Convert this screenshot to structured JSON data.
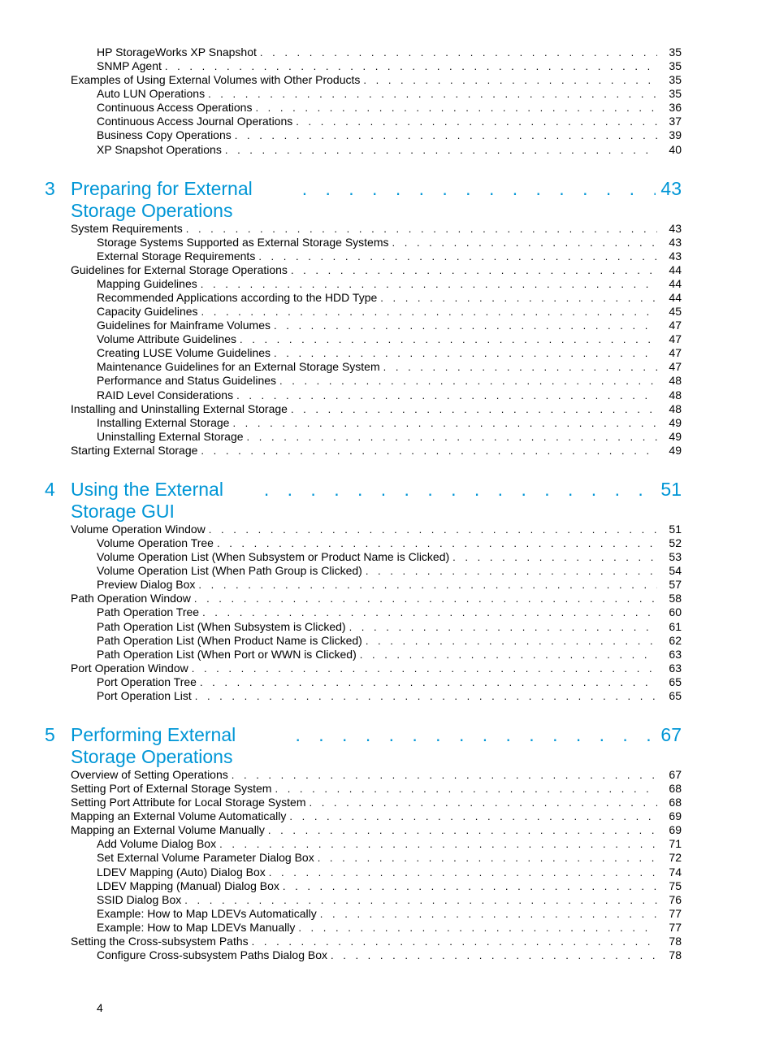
{
  "dotstring_small": ".  .  .  .  .  .  .  .  .  .  .  .  .  .  .  .  .  .  .  .  .  .  .  .  .  .  .  .  .  .  .  .  .  .  .  .  .  .  .  .  .  .  .  .  .  .  .  .  .  .  .  .",
  "dotstring_big": ". . . . . . . . . . . . . . . . . . . . . . . .",
  "page_number": "4",
  "sections": [
    {
      "title_num": "",
      "title": "",
      "title_page": "",
      "entries": [
        {
          "lvl": 2,
          "label": "HP StorageWorks XP Snapshot",
          "page": "35"
        },
        {
          "lvl": 2,
          "label": "SNMP Agent",
          "page": "35"
        },
        {
          "lvl": 1,
          "label": "Examples of Using External Volumes with Other Products",
          "page": "35"
        },
        {
          "lvl": 2,
          "label": "Auto LUN Operations",
          "page": "35"
        },
        {
          "lvl": 2,
          "label": "Continuous Access Operations",
          "page": "36"
        },
        {
          "lvl": 2,
          "label": "Continuous Access Journal Operations",
          "page": "37"
        },
        {
          "lvl": 2,
          "label": "Business Copy Operations",
          "page": "39"
        },
        {
          "lvl": 2,
          "label": "XP Snapshot Operations",
          "page": "40"
        }
      ]
    },
    {
      "title_num": "3",
      "title": "Preparing for External Storage Operations",
      "title_page": "43",
      "entries": [
        {
          "lvl": 1,
          "label": "System Requirements",
          "page": "43"
        },
        {
          "lvl": 2,
          "label": "Storage Systems Supported as External Storage Systems",
          "page": "43"
        },
        {
          "lvl": 2,
          "label": "External Storage Requirements",
          "page": "43"
        },
        {
          "lvl": 1,
          "label": "Guidelines for External Storage Operations",
          "page": "44"
        },
        {
          "lvl": 2,
          "label": "Mapping Guidelines",
          "page": "44"
        },
        {
          "lvl": 2,
          "label": "Recommended Applications according to the HDD Type",
          "page": "44"
        },
        {
          "lvl": 2,
          "label": "Capacity Guidelines",
          "page": "45"
        },
        {
          "lvl": 2,
          "label": "Guidelines for Mainframe Volumes",
          "page": "47"
        },
        {
          "lvl": 2,
          "label": "Volume Attribute Guidelines",
          "page": "47"
        },
        {
          "lvl": 2,
          "label": "Creating LUSE Volume Guidelines",
          "page": "47"
        },
        {
          "lvl": 2,
          "label": "Maintenance Guidelines for an External Storage System",
          "page": "47"
        },
        {
          "lvl": 2,
          "label": "Performance and Status Guidelines",
          "page": "48"
        },
        {
          "lvl": 2,
          "label": "RAID Level Considerations",
          "page": "48"
        },
        {
          "lvl": 1,
          "label": "Installing and Uninstalling External Storage",
          "page": "48"
        },
        {
          "lvl": 2,
          "label": "Installing External Storage",
          "page": "49"
        },
        {
          "lvl": 2,
          "label": "Uninstalling External Storage",
          "page": "49"
        },
        {
          "lvl": 1,
          "label": "Starting External Storage",
          "page": "49"
        }
      ]
    },
    {
      "title_num": "4",
      "title": "Using the External Storage GUI",
      "title_page": "51",
      "entries": [
        {
          "lvl": 1,
          "label": "Volume Operation Window",
          "page": "51"
        },
        {
          "lvl": 2,
          "label": "Volume Operation Tree",
          "page": "52"
        },
        {
          "lvl": 2,
          "label": "Volume Operation List (When Subsystem or Product Name is Clicked)",
          "page": "53"
        },
        {
          "lvl": 2,
          "label": "Volume Operation List (When Path Group is Clicked)",
          "page": "54"
        },
        {
          "lvl": 2,
          "label": "Preview Dialog Box",
          "page": "57"
        },
        {
          "lvl": 1,
          "label": "Path Operation Window",
          "page": "58"
        },
        {
          "lvl": 2,
          "label": "Path Operation Tree",
          "page": "60"
        },
        {
          "lvl": 2,
          "label": "Path Operation List (When Subsystem is Clicked)",
          "page": "61"
        },
        {
          "lvl": 2,
          "label": "Path Operation List (When Product Name is Clicked)",
          "page": "62"
        },
        {
          "lvl": 2,
          "label": "Path Operation List (When Port or WWN is Clicked)",
          "page": "63"
        },
        {
          "lvl": 1,
          "label": "Port Operation Window",
          "page": "63"
        },
        {
          "lvl": 2,
          "label": "Port Operation Tree",
          "page": "65"
        },
        {
          "lvl": 2,
          "label": "Port Operation List",
          "page": "65"
        }
      ]
    },
    {
      "title_num": "5",
      "title": "Performing External Storage Operations",
      "title_page": "67",
      "entries": [
        {
          "lvl": 1,
          "label": "Overview of Setting Operations",
          "page": "67"
        },
        {
          "lvl": 1,
          "label": "Setting Port of External Storage System",
          "page": "68"
        },
        {
          "lvl": 1,
          "label": "Setting Port Attribute for Local Storage System",
          "page": "68"
        },
        {
          "lvl": 1,
          "label": "Mapping an External Volume Automatically",
          "page": "69"
        },
        {
          "lvl": 1,
          "label": "Mapping an External Volume Manually",
          "page": "69"
        },
        {
          "lvl": 2,
          "label": "Add Volume Dialog Box",
          "page": "71"
        },
        {
          "lvl": 2,
          "label": "Set External Volume Parameter Dialog Box",
          "page": "72"
        },
        {
          "lvl": 2,
          "label": "LDEV Mapping (Auto) Dialog Box",
          "page": "74"
        },
        {
          "lvl": 2,
          "label": "LDEV Mapping (Manual) Dialog Box",
          "page": "75"
        },
        {
          "lvl": 2,
          "label": "SSID Dialog Box",
          "page": "76"
        },
        {
          "lvl": 2,
          "label": "Example: How to Map LDEVs Automatically",
          "page": "77"
        },
        {
          "lvl": 2,
          "label": "Example: How to Map LDEVs Manually",
          "page": "77"
        },
        {
          "lvl": 1,
          "label": "Setting the Cross-subsystem Paths",
          "page": "78"
        },
        {
          "lvl": 2,
          "label": "Configure Cross-subsystem Paths Dialog Box",
          "page": "78"
        }
      ]
    }
  ]
}
